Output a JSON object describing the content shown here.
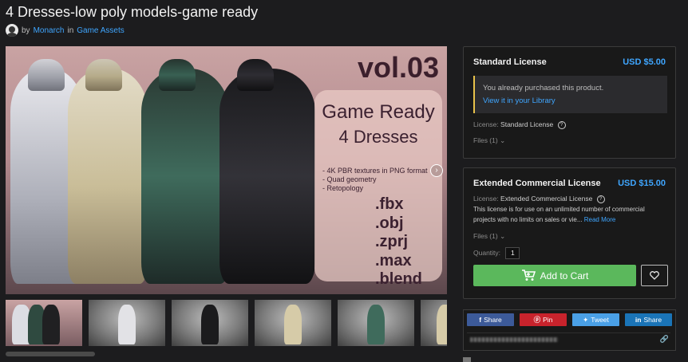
{
  "page": {
    "title": "4 Dresses-low poly models-game ready",
    "by_label": "by",
    "author": "Monarch",
    "in_label": "in",
    "category": "Game Assets"
  },
  "hero": {
    "vol": "vol.03",
    "headline1": "Game Ready",
    "headline2": "4 Dresses",
    "features": [
      "- 4K PBR textures in PNG format",
      "- Quad geometry",
      "- Retopology"
    ],
    "extensions": [
      ".fbx",
      ".obj",
      ".zprj",
      ".max",
      ".blend"
    ],
    "next_icon": "chevron-right-circle-icon"
  },
  "thumbnails": [
    "thumb-1",
    "thumb-2",
    "thumb-3",
    "thumb-4",
    "thumb-5",
    "thumb-6"
  ],
  "standard_license": {
    "name": "Standard License",
    "price": "USD $5.00",
    "notice": "You already purchased this product.",
    "library_link": "View it in your Library",
    "license_label": "License:",
    "license_value": "Standard License",
    "files_label": "Files (1)"
  },
  "extended_license": {
    "name": "Extended Commercial License",
    "price": "USD $15.00",
    "license_label": "License:",
    "license_value": "Extended Commercial License",
    "description": "This license is for use on an unlimited number of commercial projects with no limits on sales or vie...",
    "read_more": "Read More",
    "files_label": "Files (1)",
    "quantity_label": "Quantity:",
    "quantity_value": "1",
    "add_to_cart": "Add to Cart"
  },
  "share": {
    "facebook": "Share",
    "pinterest": "Pin",
    "twitter": "Tweet",
    "linkedin": "Share"
  },
  "colors": {
    "accent": "#3fa6ff",
    "cart_green": "#5bb85c",
    "notice_border": "#e8c24a",
    "background": "#1c1c1e"
  }
}
